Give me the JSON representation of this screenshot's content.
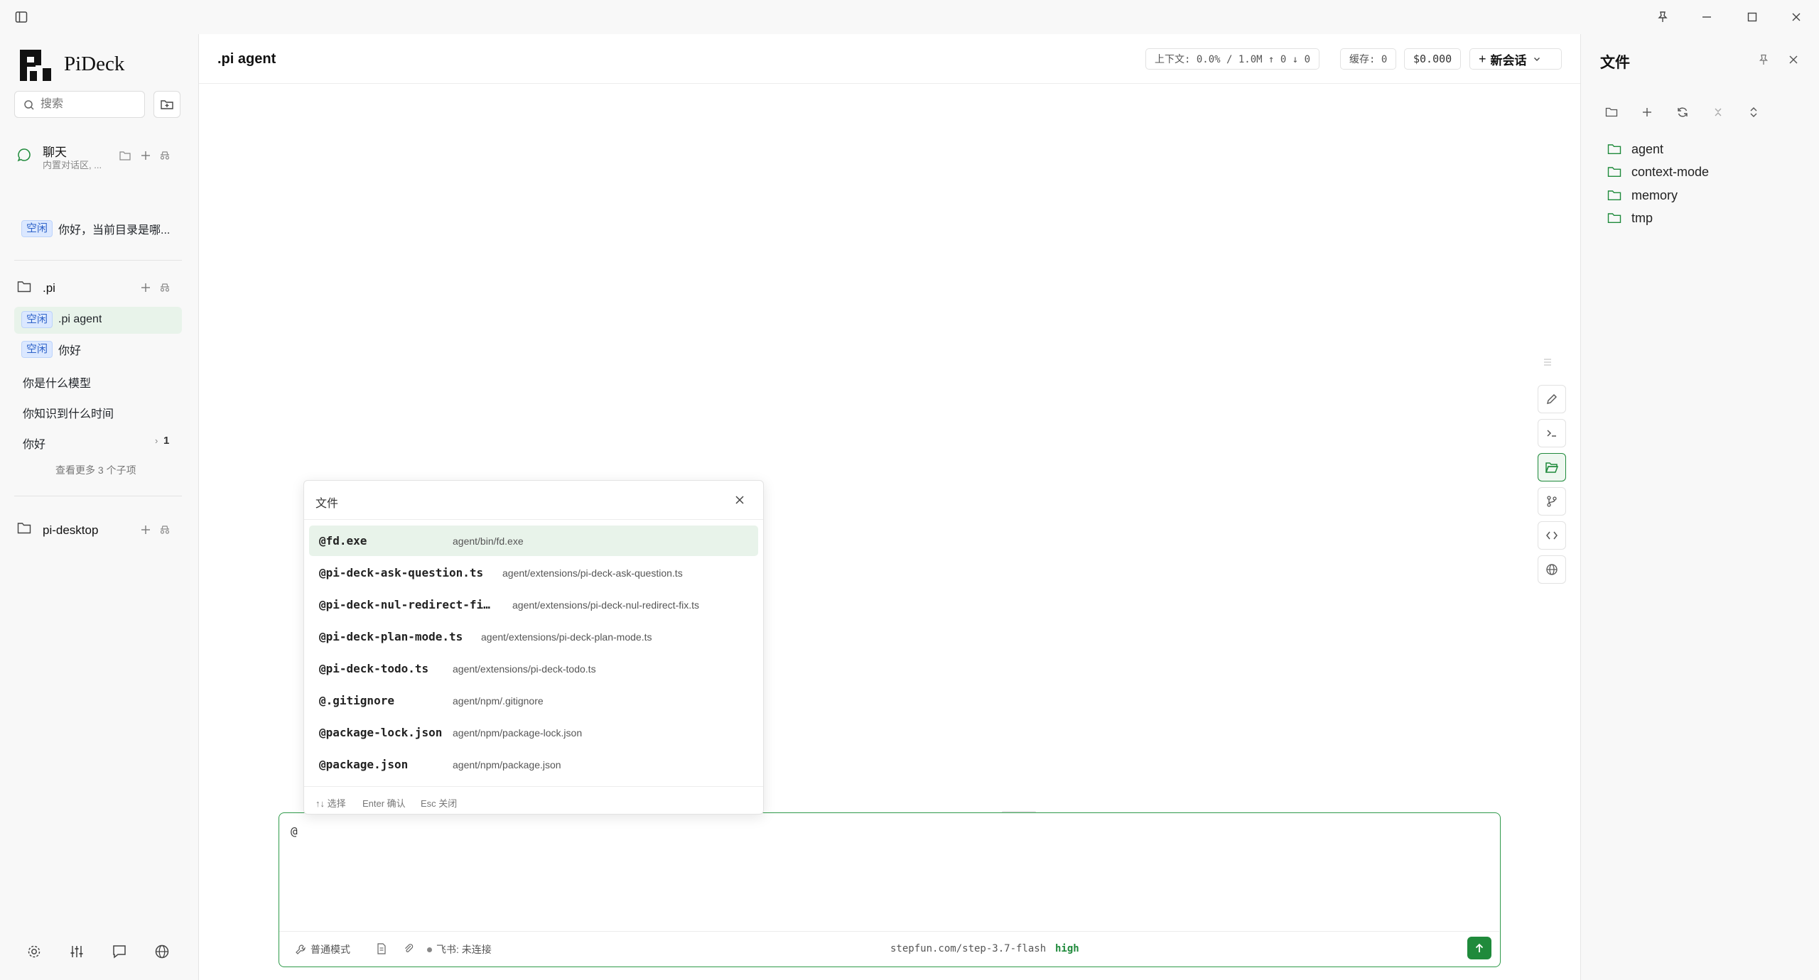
{
  "app": {
    "name": "PiDeck"
  },
  "sidebar": {
    "search_placeholder": "搜索",
    "chat_group": {
      "title": "聊天",
      "subtitle": "内置对话区, ...",
      "items": [
        {
          "badge": "空闲",
          "label": "你好，当前目录是哪..."
        }
      ]
    },
    "pi_group": {
      "title": ".pi",
      "items": [
        {
          "badge": "空闲",
          "label": ".pi agent"
        },
        {
          "badge": "空闲",
          "label": "你好"
        },
        {
          "label": "你是什么模型"
        },
        {
          "label": "你知识到什么时间"
        },
        {
          "label": "你好",
          "count": "1"
        }
      ],
      "more": "查看更多 3 个子项"
    },
    "desktop_group": {
      "title": "pi-desktop"
    }
  },
  "header": {
    "title": ".pi agent",
    "context": "上下文: 0.0% / 1.0M ↑ 0 ↓ 0",
    "cache": "缓存: 0",
    "cost": "$0.000",
    "new_session": "新会话"
  },
  "popup": {
    "title": "文件",
    "files": [
      {
        "name": "@fd.exe",
        "path": "agent/bin/fd.exe"
      },
      {
        "name": "@pi-deck-ask-question.ts",
        "path": "agent/extensions/pi-deck-ask-question.ts"
      },
      {
        "name": "@pi-deck-nul-redirect-fi…",
        "path": "agent/extensions/pi-deck-nul-redirect-fix.ts"
      },
      {
        "name": "@pi-deck-plan-mode.ts",
        "path": "agent/extensions/pi-deck-plan-mode.ts"
      },
      {
        "name": "@pi-deck-todo.ts",
        "path": "agent/extensions/pi-deck-todo.ts"
      },
      {
        "name": "@.gitignore",
        "path": "agent/npm/.gitignore"
      },
      {
        "name": "@package-lock.json",
        "path": "agent/npm/package-lock.json"
      },
      {
        "name": "@package.json",
        "path": "agent/npm/package.json"
      }
    ],
    "footer": {
      "select": "↑↓ 选择",
      "confirm": "Enter 确认",
      "close": "Esc 关闭"
    }
  },
  "composer": {
    "value": "@",
    "mode": "普通模式",
    "feishu": "飞书: 未连接",
    "model": "stepfun.com/step-3.7-flash",
    "effort": "high"
  },
  "files_panel": {
    "title": "文件",
    "tree": [
      "agent",
      "context-mode",
      "memory",
      "tmp"
    ]
  },
  "colors": {
    "accent": "#1f8a3b",
    "selected_bg": "#e8f3ea",
    "badge_bg": "#dbe8ff",
    "badge_text": "#2f63c9"
  }
}
